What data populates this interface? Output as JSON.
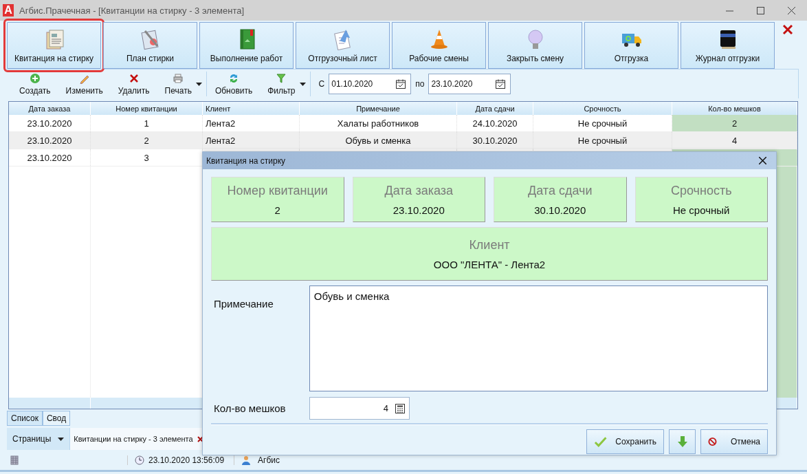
{
  "window": {
    "logo": "A",
    "title": "Агбис.Прачечная - [Квитанции на стирку - 3 элемента]"
  },
  "ribbon": [
    {
      "label": "Квитанция на стирку",
      "selected": true
    },
    {
      "label": "План стирки",
      "selected": false
    },
    {
      "label": "Выполнение работ",
      "selected": false
    },
    {
      "label": "Отгрузочный лист",
      "selected": false
    },
    {
      "label": "Рабочие смены",
      "selected": false
    },
    {
      "label": "Закрыть смену",
      "selected": false
    },
    {
      "label": "Отгрузка",
      "selected": false
    },
    {
      "label": "Журнал отгрузки",
      "selected": false
    }
  ],
  "toolbar": {
    "buttons": [
      {
        "kind": "create",
        "label": "Создать",
        "has_menu": false
      },
      {
        "kind": "edit",
        "label": "Изменить",
        "has_menu": false
      },
      {
        "kind": "delete",
        "label": "Удалить",
        "has_menu": false
      },
      {
        "kind": "print",
        "label": "Печать",
        "has_menu": true
      },
      {
        "kind": "refresh",
        "label": "Обновить",
        "has_menu": false
      },
      {
        "kind": "filter",
        "label": "Фильтр",
        "has_menu": true
      }
    ],
    "from_label": "С",
    "from": "01.10.2020",
    "to_label": "по",
    "to": "23.10.2020"
  },
  "table": {
    "columns": [
      "Дата заказа",
      "Номер квитанции",
      "Клиент",
      "Примечание",
      "Дата сдачи",
      "Срочность",
      "Кол-во мешков"
    ],
    "rows": [
      {
        "selected": false,
        "cells": [
          "23.10.2020",
          "1",
          "Лента2",
          "Халаты работников",
          "24.10.2020",
          "Не срочный",
          "2"
        ]
      },
      {
        "selected": true,
        "cells": [
          "23.10.2020",
          "2",
          "Лента2",
          "Обувь и сменка",
          "30.10.2020",
          "Не срочный",
          "4"
        ]
      },
      {
        "selected": false,
        "cells": [
          "23.10.2020",
          "3"
        ]
      }
    ]
  },
  "view_tabs": [
    {
      "label": "Список",
      "selected": true
    },
    {
      "label": "Свод",
      "selected": false
    }
  ],
  "pages": {
    "button": "Страницы",
    "tabs": [
      {
        "label": "Квитанции на стирку - 3 элемента"
      }
    ]
  },
  "status_bar": {
    "datetime": "23.10.2020 13:56:09",
    "user": "Агбис"
  },
  "dialog": {
    "title": "Квитанция на стирку",
    "cards": [
      {
        "label": "Номер квитанции",
        "value": "2"
      },
      {
        "label": "Дата заказа",
        "value": "23.10.2020"
      },
      {
        "label": "Дата сдачи",
        "value": "30.10.2020"
      },
      {
        "label": "Срочность",
        "value": "Не срочный"
      }
    ],
    "client": {
      "label": "Клиент",
      "value": "ООО \"ЛЕНТА\" - Лента2"
    },
    "note": {
      "label": "Примечание",
      "value": "Обувь и сменка"
    },
    "bags": {
      "label": "Кол-во мешков",
      "value": "4"
    },
    "buttons": [
      {
        "kind": "save",
        "label": "Сохранить"
      },
      {
        "kind": "down"
      },
      {
        "kind": "cancel",
        "label": "Отмена"
      }
    ]
  }
}
